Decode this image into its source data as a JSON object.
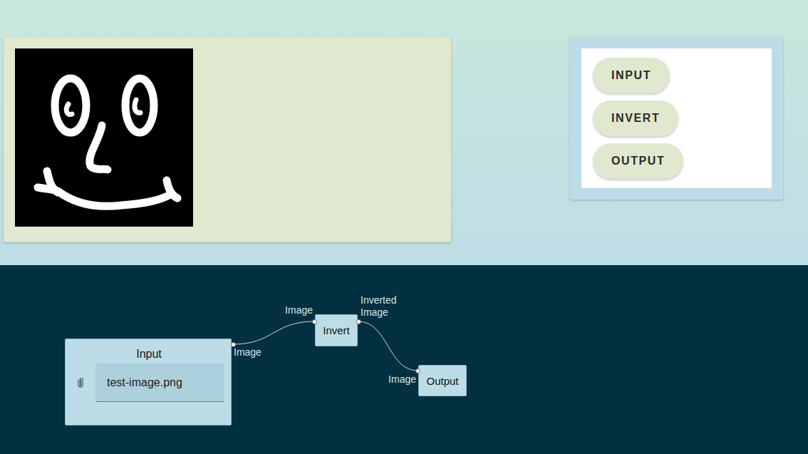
{
  "toolbox": {
    "buttons": [
      "INPUT",
      "INVERT",
      "OUTPUT"
    ]
  },
  "graph": {
    "nodes": [
      {
        "title": "Input",
        "kind": "input",
        "file": "test-image.png",
        "inputs": [],
        "outputs": [
          "Image"
        ]
      },
      {
        "title": "Invert",
        "kind": "process",
        "inputs": [
          "Image"
        ],
        "outputs": [
          "Inverted Image"
        ]
      },
      {
        "title": "Output",
        "kind": "output",
        "inputs": [
          "Image"
        ],
        "outputs": []
      }
    ],
    "edges": [
      {
        "from": "Input",
        "to": "Invert"
      },
      {
        "from": "Invert",
        "to": "Output"
      }
    ]
  }
}
